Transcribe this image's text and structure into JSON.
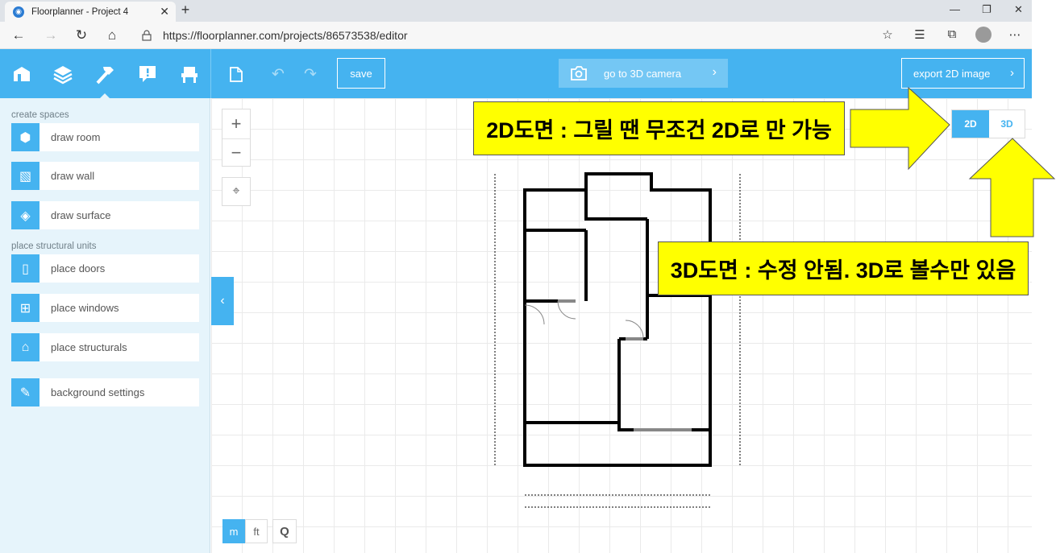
{
  "browser": {
    "tab_title": "Floorplanner - Project 4",
    "url": "https://floorplanner.com/projects/86573538/editor"
  },
  "toolbar": {
    "save_label": "save",
    "camera_label": "go to 3D camera",
    "export_label": "export 2D image"
  },
  "sidebar": {
    "section_create": "create spaces",
    "section_structural": "place structural units",
    "items": [
      {
        "label": "draw room",
        "icon": "cube-icon"
      },
      {
        "label": "draw wall",
        "icon": "wall-icon"
      },
      {
        "label": "draw surface",
        "icon": "surface-icon"
      },
      {
        "label": "place doors",
        "icon": "door-icon"
      },
      {
        "label": "place windows",
        "icon": "window-icon"
      },
      {
        "label": "place structurals",
        "icon": "fireplace-icon"
      },
      {
        "label": "background settings",
        "icon": "edit-icon"
      }
    ]
  },
  "canvas": {
    "unit_m": "m",
    "unit_ft": "ft",
    "view_2d": "2D",
    "view_3d": "3D"
  },
  "annotations": {
    "note_2d": "2D도면 : 그릴 땐 무조건 2D로 만 가능",
    "note_3d": "3D도면 : 수정 안됨. 3D로 볼수만 있음"
  },
  "colors": {
    "accent": "#45b3f0",
    "sidebar_bg": "#e6f4fb",
    "note_bg": "#ffff00"
  }
}
